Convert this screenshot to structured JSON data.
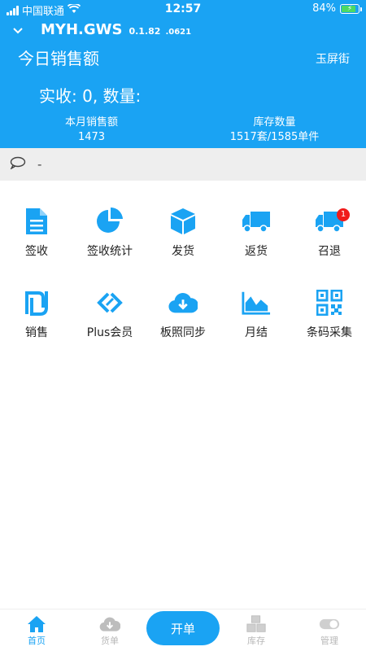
{
  "status_bar": {
    "carrier": "中国联通",
    "time": "12:57",
    "battery": "84%",
    "battery_level": 0.84
  },
  "header": {
    "app_title": "MYH.GWS",
    "version": "0.1.82",
    "build": ".0621",
    "today_title": "今日销售额",
    "store_name": "玉屏街",
    "received_text": "实收: 0, 数量:",
    "stats": [
      {
        "label": "本月销售额",
        "value": "1473"
      },
      {
        "label": "库存数量",
        "value": "1517套/1585单件"
      }
    ]
  },
  "notice": {
    "text": "-"
  },
  "grid": {
    "rows": [
      [
        {
          "label": "签收",
          "icon": "document-icon"
        },
        {
          "label": "签收统计",
          "icon": "pie-chart-icon"
        },
        {
          "label": "发货",
          "icon": "box-icon"
        },
        {
          "label": "返货",
          "icon": "truck-icon"
        },
        {
          "label": "召退",
          "icon": "truck-icon",
          "badge": "1"
        }
      ],
      [
        {
          "label": "销售",
          "icon": "shekel-icon"
        },
        {
          "label": "Plus会员",
          "icon": "link-icon"
        },
        {
          "label": "板照同步",
          "icon": "cloud-download-icon"
        },
        {
          "label": "月结",
          "icon": "area-chart-icon"
        },
        {
          "label": "条码采集",
          "icon": "qrcode-icon"
        }
      ]
    ]
  },
  "tabbar": {
    "tabs": [
      {
        "label": "首页",
        "icon": "home-icon",
        "active": true
      },
      {
        "label": "货单",
        "icon": "cloud-download-icon"
      },
      {
        "label": "库存",
        "icon": "boxes-icon"
      },
      {
        "label": "管理",
        "icon": "toggle-icon"
      }
    ],
    "fab_label": "开单"
  },
  "colors": {
    "accent": "#1aa3f3",
    "badge": "#f01b1b",
    "inactive": "#b7b7b7"
  }
}
